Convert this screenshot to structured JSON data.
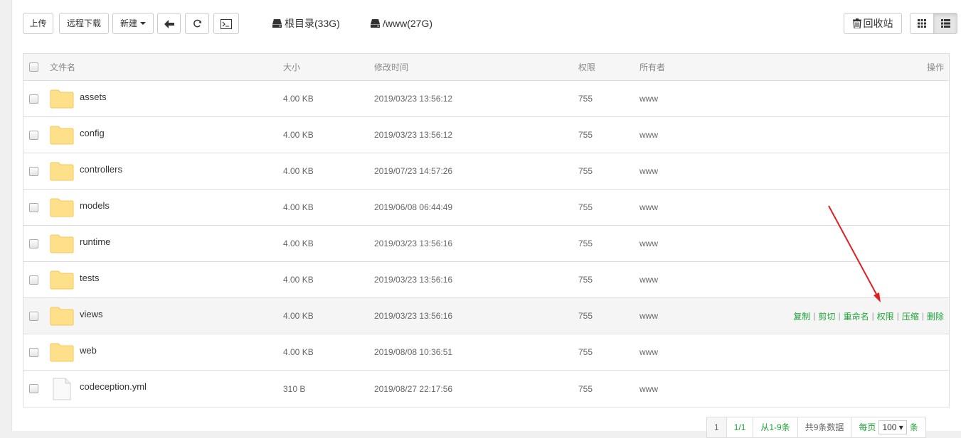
{
  "toolbar": {
    "upload": "上传",
    "remote_download": "远程下载",
    "new": "新建",
    "disks": [
      {
        "label": "根目录(33G)"
      },
      {
        "label": "/www(27G)"
      }
    ],
    "recycle": "回收站"
  },
  "table": {
    "headers": {
      "name": "文件名",
      "size": "大小",
      "mtime": "修改时间",
      "perm": "权限",
      "owner": "所有者",
      "ops": "操作"
    },
    "rows": [
      {
        "name": "assets",
        "type": "folder",
        "size": "4.00 KB",
        "mtime": "2019/03/23 13:56:12",
        "perm": "755",
        "owner": "www"
      },
      {
        "name": "config",
        "type": "folder",
        "size": "4.00 KB",
        "mtime": "2019/03/23 13:56:12",
        "perm": "755",
        "owner": "www"
      },
      {
        "name": "controllers",
        "type": "folder",
        "size": "4.00 KB",
        "mtime": "2019/07/23 14:57:26",
        "perm": "755",
        "owner": "www"
      },
      {
        "name": "models",
        "type": "folder",
        "size": "4.00 KB",
        "mtime": "2019/06/08 06:44:49",
        "perm": "755",
        "owner": "www"
      },
      {
        "name": "runtime",
        "type": "folder",
        "size": "4.00 KB",
        "mtime": "2019/03/23 13:56:16",
        "perm": "755",
        "owner": "www"
      },
      {
        "name": "tests",
        "type": "folder",
        "size": "4.00 KB",
        "mtime": "2019/03/23 13:56:16",
        "perm": "755",
        "owner": "www"
      },
      {
        "name": "views",
        "type": "folder",
        "size": "4.00 KB",
        "mtime": "2019/03/23 13:56:16",
        "perm": "755",
        "owner": "www",
        "hover": true
      },
      {
        "name": "web",
        "type": "folder",
        "size": "4.00 KB",
        "mtime": "2019/08/08 10:36:51",
        "perm": "755",
        "owner": "www"
      },
      {
        "name": "codeception.yml",
        "type": "file",
        "size": "310 B",
        "mtime": "2019/08/27 22:17:56",
        "perm": "755",
        "owner": "www"
      }
    ],
    "row_ops": [
      "复制",
      "剪切",
      "重命名",
      "权限",
      "压缩",
      "删除"
    ]
  },
  "pager": {
    "current": "1",
    "pages": "1/1",
    "range": "从1-9条",
    "total": "共9条数据",
    "per_page_label": "每页",
    "per_page_value": "100",
    "per_page_unit": "条"
  },
  "colors": {
    "accent": "#20a53a",
    "folder": "#ffe08a",
    "annotation_arrow": "#e02020"
  }
}
